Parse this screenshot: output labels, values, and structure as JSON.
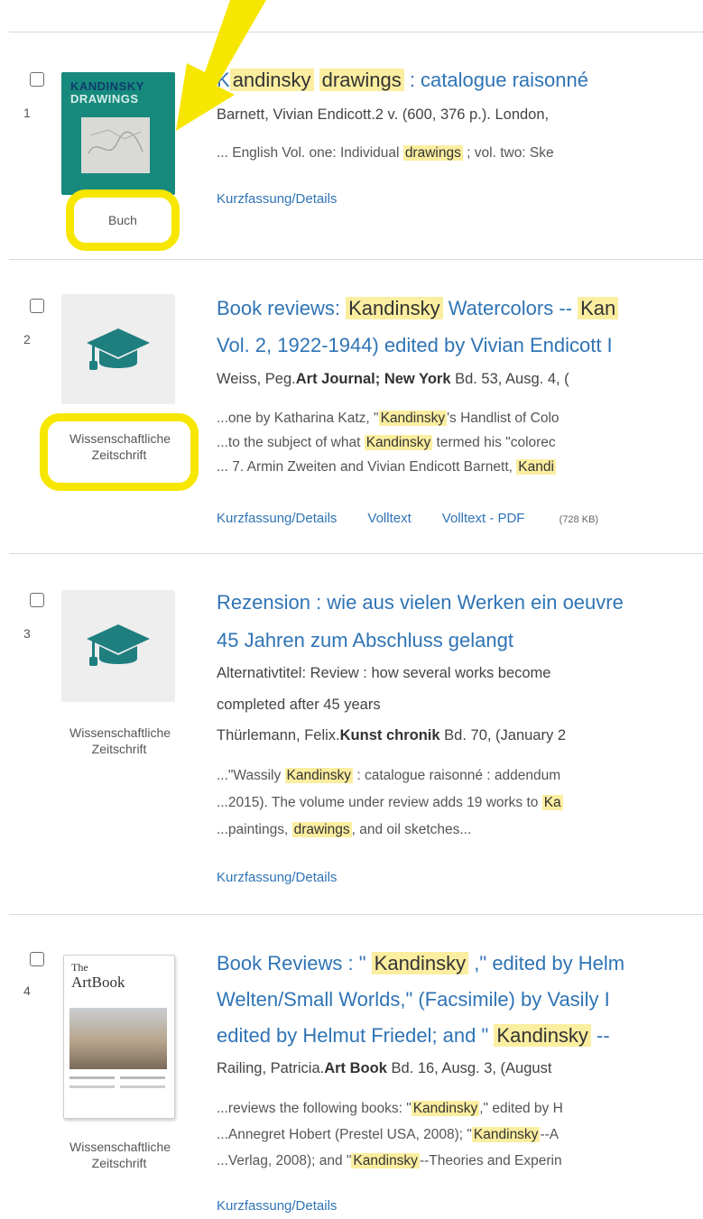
{
  "results": [
    {
      "num": "1",
      "type": "Buch",
      "cover": {
        "line1": "KANDINSKY",
        "line2": "DRAWINGS"
      },
      "title": {
        "t0": "K",
        "hl1": "andinsky",
        "t1": " ",
        "hl2": "drawings",
        "t2": " : catalogue raisonné"
      },
      "meta": "Barnett, Vivian Endicott.2 v. (600, 376 p.). London, ",
      "snippet": {
        "a": "... English Vol. one: Individual ",
        "hl": "drawings",
        "b": " ; vol. two: Ske"
      },
      "links": [
        "Kurzfassung/Details"
      ]
    },
    {
      "num": "2",
      "type": "Wissenschaftliche Zeitschrift",
      "title_line1": {
        "a": "Book reviews: ",
        "hl1": "Kandinsky",
        "b": " Watercolors -- ",
        "hl2": "Kan"
      },
      "title_line2": "Vol. 2, 1922-1944) edited by Vivian Endicott I",
      "meta": {
        "a": "Weiss, Peg.",
        "b": "Art Journal; New York",
        "c": " Bd. 53, Ausg. 4, ("
      },
      "snippets": [
        {
          "a": "...one by Katharina Katz, \"",
          "hl": "Kandinsky",
          "b": "'s Handlist of Colo"
        },
        {
          "a": "...to the subject of what ",
          "hl": "Kandinsky",
          "b": " termed his \"colorec"
        },
        {
          "a": "... 7. Armin Zweiten and Vivian Endicott Barnett, ",
          "hl": "Kandi",
          "b": ""
        }
      ],
      "links": [
        "Kurzfassung/Details",
        "Volltext",
        "Volltext - PDF"
      ],
      "pdf_size": "(728 KB)"
    },
    {
      "num": "3",
      "type": "Wissenschaftliche Zeitschrift",
      "title_line1": "Rezension : wie aus vielen Werken ein oeuvre",
      "title_line2": "45 Jahren zum Abschluss gelangt",
      "alt1": "Alternativtitel: Review : how several works become",
      "alt2": "completed after 45 years",
      "meta": {
        "a": "Thürlemann, Felix.",
        "b": "Kunst chronik",
        "c": " Bd. 70,  (January 2"
      },
      "snippets": [
        {
          "a": "...\"Wassily ",
          "hl": "Kandinsky",
          "b": " : catalogue raisonné : addendum"
        },
        {
          "a": "...2015). The volume under review adds 19 works to ",
          "hl": "Ka",
          "b": ""
        },
        {
          "a": "...paintings, ",
          "hl": "drawings",
          "b": ", and oil sketches..."
        }
      ],
      "links": [
        "Kurzfassung/Details"
      ]
    },
    {
      "num": "4",
      "type": "Wissenschaftliche Zeitschrift",
      "cover": {
        "line1": "The",
        "line2": "ArtBook"
      },
      "title_line1": {
        "a": "Book Reviews : \" ",
        "hl": "Kandinsky",
        "b": " ,\" edited by Helm"
      },
      "title_line2": "Welten/Small Worlds,\" (Facsimile) by Vasily I",
      "title_line3": {
        "a": "edited by Helmut Friedel; and \" ",
        "hl": "Kandinsky",
        "b": " --"
      },
      "meta": {
        "a": "Railing, Patricia.",
        "b": "Art Book",
        "c": " Bd. 16, Ausg. 3,  (August"
      },
      "snippets": [
        {
          "a": "...reviews the following books: \"",
          "hl": "Kandinsky",
          "b": ",\" edited by H"
        },
        {
          "a": "...Annegret Hobert (Prestel USA, 2008); \"",
          "hl": "Kandinsky",
          "b": "--A"
        },
        {
          "a": "...Verlag, 2008); and \"",
          "hl": "Kandinsky",
          "b": "--Theories and Experin"
        }
      ],
      "links": [
        "Kurzfassung/Details"
      ]
    }
  ],
  "colors": {
    "link": "#2f74b5",
    "highlight": "#fbeea0",
    "annotation": "#f7e600",
    "cover_teal": "#17897d"
  },
  "icons": [
    "graduation-cap-icon",
    "annotation-arrow-icon"
  ]
}
